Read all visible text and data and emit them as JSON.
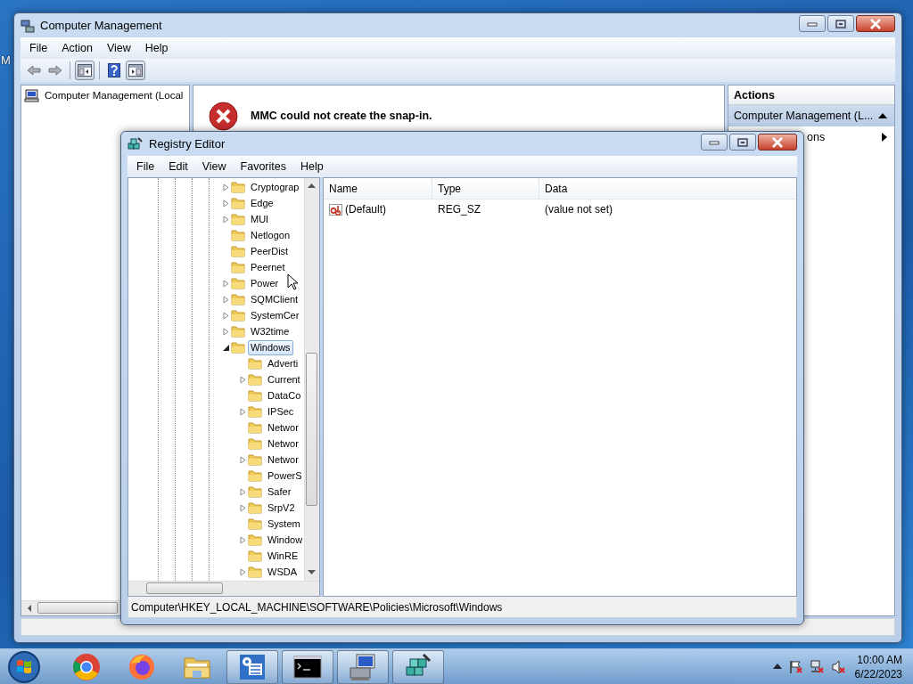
{
  "desktop": {
    "icon_label": "M"
  },
  "mmc": {
    "title": "Computer Management",
    "menu": [
      "File",
      "Action",
      "View",
      "Help"
    ],
    "toolbar": [
      {
        "kind": "back",
        "disabled": true
      },
      {
        "kind": "forward",
        "disabled": true
      },
      {
        "kind": "separator"
      },
      {
        "kind": "console-tree",
        "pressed": true
      },
      {
        "kind": "separator"
      },
      {
        "kind": "help",
        "pressed": false
      },
      {
        "kind": "action-pane",
        "pressed": true
      }
    ],
    "tree": [
      {
        "label": "Computer Management (Local",
        "selected": false
      }
    ],
    "error": "MMC could not create the snap-in.",
    "actions": {
      "header": "Actions",
      "items": [
        {
          "label": "Computer Management (L...",
          "kind": "section"
        },
        {
          "label": "ons",
          "kind": "submenu"
        }
      ]
    }
  },
  "regedit": {
    "title": "Registry Editor",
    "menu": [
      "File",
      "Edit",
      "View",
      "Favorites",
      "Help"
    ],
    "tree": [
      {
        "label": "Cryptograp",
        "expanded": false,
        "selected": false
      },
      {
        "label": "Edge",
        "expanded": false,
        "selected": false
      },
      {
        "label": "MUI",
        "expanded": false,
        "selected": false
      },
      {
        "label": "Netlogon",
        "selected": false
      },
      {
        "label": "PeerDist",
        "selected": false
      },
      {
        "label": "Peernet",
        "selected": false
      },
      {
        "label": "Power",
        "expanded": false,
        "selected": false
      },
      {
        "label": "SQMClient",
        "expanded": false,
        "selected": false
      },
      {
        "label": "SystemCer",
        "expanded": false,
        "selected": false
      },
      {
        "label": "W32time",
        "expanded": false,
        "selected": false
      },
      {
        "label": "Windows",
        "expanded": true,
        "selected": true,
        "children": [
          {
            "label": "Adverti",
            "selected": false
          },
          {
            "label": "Current",
            "expanded": false,
            "selected": false
          },
          {
            "label": "DataCo",
            "selected": false
          },
          {
            "label": "IPSec",
            "expanded": false,
            "selected": false
          },
          {
            "label": "Networ",
            "selected": false
          },
          {
            "label": "Networ",
            "selected": false
          },
          {
            "label": "Networ",
            "expanded": false,
            "selected": false
          },
          {
            "label": "PowerS",
            "selected": false
          },
          {
            "label": "Safer",
            "expanded": false,
            "selected": false
          },
          {
            "label": "SrpV2",
            "expanded": false,
            "selected": false
          },
          {
            "label": "System",
            "selected": false
          },
          {
            "label": "Window",
            "expanded": false,
            "selected": false
          },
          {
            "label": "WinRE",
            "selected": false
          },
          {
            "label": "WSDA",
            "expanded": false,
            "selected": false
          }
        ]
      }
    ],
    "columns": [
      "Name",
      "Type",
      "Data"
    ],
    "rows": [
      {
        "name": "(Default)",
        "type": "REG_SZ",
        "data": "(value not set)"
      }
    ],
    "status_bar": "Computer\\HKEY_LOCAL_MACHINE\\SOFTWARE\\Policies\\Microsoft\\Windows"
  },
  "taskbar": {
    "apps": [
      {
        "kind": "chrome",
        "running": false
      },
      {
        "kind": "firefox",
        "running": false
      },
      {
        "kind": "explorer",
        "running": false
      },
      {
        "kind": "mmc",
        "running": true
      },
      {
        "kind": "cmd",
        "running": true
      },
      {
        "kind": "remote",
        "running": true
      },
      {
        "kind": "regedit",
        "running": true
      }
    ],
    "tray": [
      {
        "kind": "show-hidden"
      },
      {
        "kind": "action-center",
        "alert": true
      },
      {
        "kind": "network",
        "alert": true
      },
      {
        "kind": "volume",
        "muted": true
      }
    ],
    "clock": {
      "time": "10:00 AM",
      "date": "6/22/2023"
    }
  }
}
